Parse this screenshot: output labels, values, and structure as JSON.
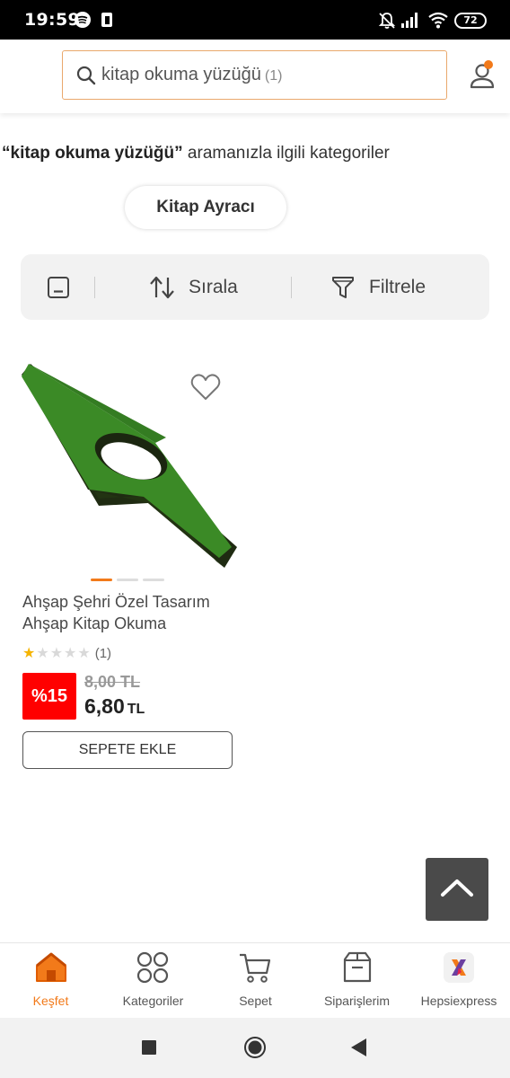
{
  "status_bar": {
    "time": "19:59",
    "battery": "72"
  },
  "search": {
    "query": "kitap okuma yüzüğü",
    "count": "(1)"
  },
  "categories": {
    "query_label": "“kitap okuma yüzüğü”",
    "suffix": " aramanızla ilgili kategoriler",
    "chips": [
      "Kitap Ayracı"
    ]
  },
  "toolbar": {
    "sort_label": "Sırala",
    "filter_label": "Filtrele"
  },
  "product": {
    "name": "Ahşap Şehri Özel Tasarım Ahşap Kitap Okuma",
    "rating": 1,
    "review_count": "(1)",
    "discount": "%15",
    "old_price": "8,00 TL",
    "price": "6,80",
    "currency": "TL",
    "add_to_cart": "SEPETE EKLE",
    "image_color": "#3b8a26"
  },
  "bottom_nav": [
    {
      "label": "Keşfet",
      "icon": "home-icon",
      "active": true
    },
    {
      "label": "Kategoriler",
      "icon": "categories-icon",
      "active": false
    },
    {
      "label": "Sepet",
      "icon": "cart-icon",
      "active": false
    },
    {
      "label": "Siparişlerim",
      "icon": "orders-icon",
      "active": false
    },
    {
      "label": "Hepsiexpress",
      "icon": "hepsiexpress-icon",
      "active": false
    }
  ],
  "colors": {
    "accent": "#f27a1a",
    "discount": "#ff0000"
  }
}
